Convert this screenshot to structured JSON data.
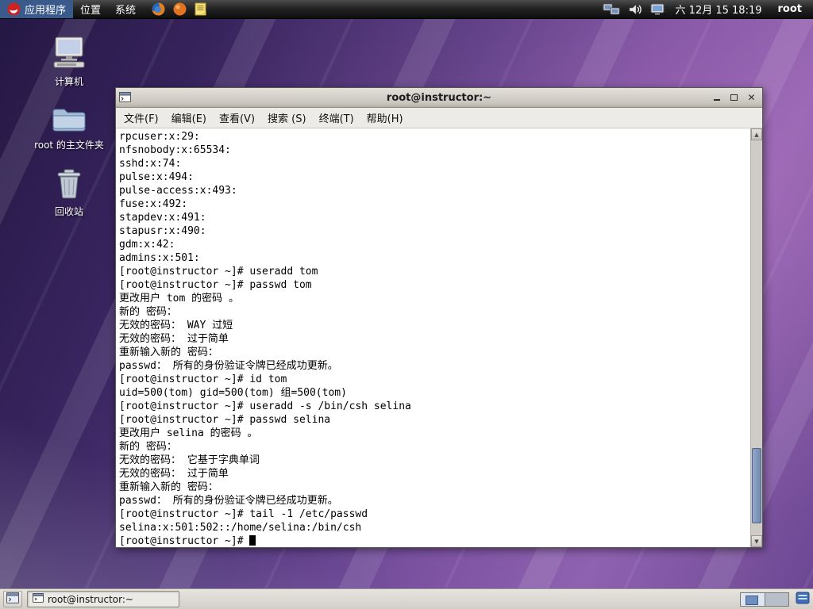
{
  "top_panel": {
    "menus": [
      {
        "label": "应用程序"
      },
      {
        "label": "位置"
      },
      {
        "label": "系统"
      }
    ],
    "clock": "六 12月 15 18:19",
    "user": "root"
  },
  "desktop_icons": [
    {
      "label": "计算机"
    },
    {
      "label": "root 的主文件夹"
    },
    {
      "label": "回收站"
    }
  ],
  "window": {
    "title": "root@instructor:~",
    "menu_items": [
      "文件(F)",
      "编辑(E)",
      "查看(V)",
      "搜索 (S)",
      "终端(T)",
      "帮助(H)"
    ],
    "terminal_lines": [
      "rpcuser:x:29:",
      "nfsnobody:x:65534:",
      "sshd:x:74:",
      "pulse:x:494:",
      "pulse-access:x:493:",
      "fuse:x:492:",
      "stapdev:x:491:",
      "stapusr:x:490:",
      "gdm:x:42:",
      "admins:x:501:",
      "[root@instructor ~]# useradd tom",
      "[root@instructor ~]# passwd tom",
      "更改用户 tom 的密码 。",
      "新的 密码：",
      "无效的密码： WAY 过短",
      "无效的密码： 过于简单",
      "重新输入新的 密码：",
      "passwd： 所有的身份验证令牌已经成功更新。",
      "[root@instructor ~]# id tom",
      "uid=500(tom) gid=500(tom) 组=500(tom)",
      "[root@instructor ~]# useradd -s /bin/csh selina",
      "[root@instructor ~]# passwd selina",
      "更改用户 selina 的密码 。",
      "新的 密码：",
      "无效的密码： 它基于字典单词",
      "无效的密码： 过于简单",
      "重新输入新的 密码：",
      "passwd： 所有的身份验证令牌已经成功更新。",
      "[root@instructor ~]# tail -1 /etc/passwd",
      "selina:x:501:502::/home/selina:/bin/csh",
      "[root@instructor ~]# "
    ]
  },
  "taskbar": {
    "window_button": "root@instructor:~"
  },
  "colors": {
    "panel_black": "#1a1a1a",
    "accent_blue": "#7289ad",
    "terminal_bg": "#ffffff",
    "terminal_fg": "#000000",
    "wallpaper_purple": "#6b4691"
  }
}
